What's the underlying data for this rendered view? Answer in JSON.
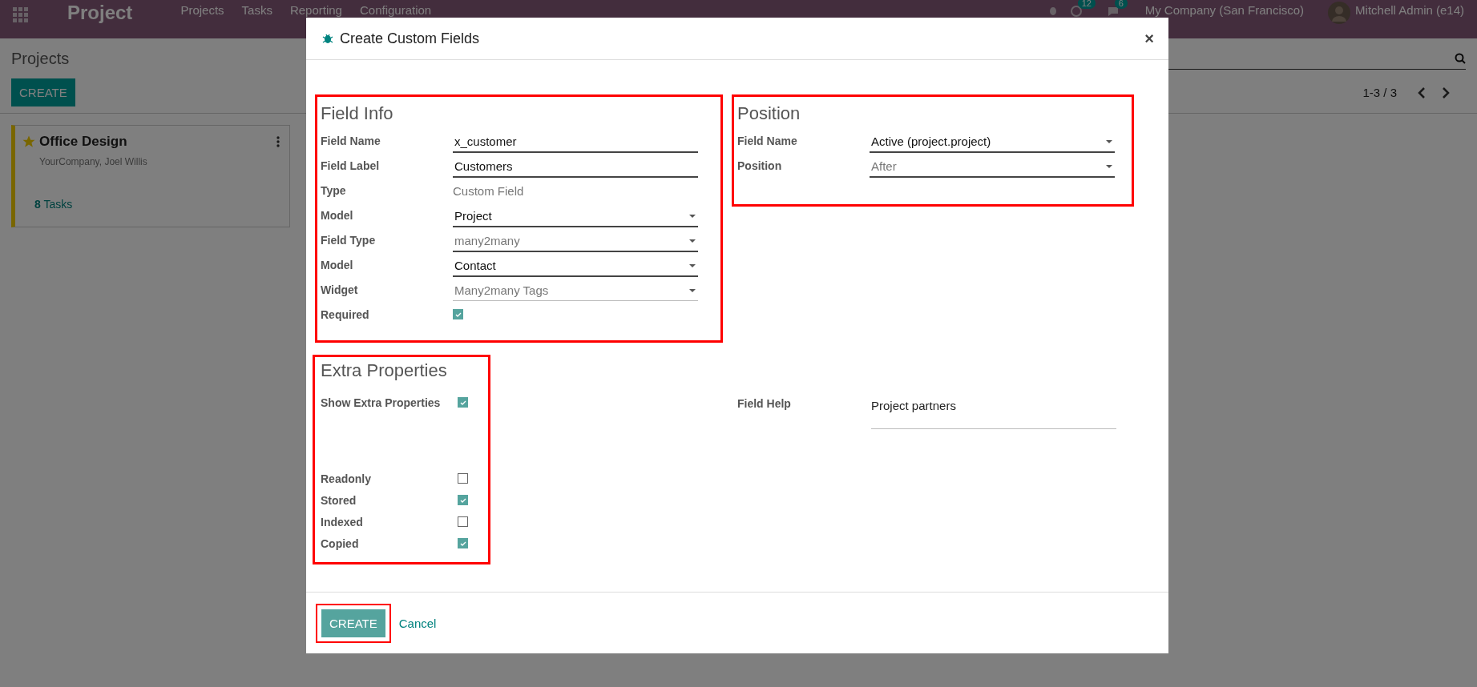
{
  "navbar": {
    "app_title": "Project",
    "menu": [
      "Projects",
      "Tasks",
      "Reporting",
      "Configuration"
    ],
    "activity_badge": "12",
    "messages_badge": "6",
    "company": "My Company (San Francisco)",
    "user": "Mitchell Admin (e14)"
  },
  "control_panel": {
    "title": "Projects",
    "create_button": "CREATE",
    "pager": "1-3 / 3"
  },
  "kanban_card": {
    "title": "Office Design",
    "favorite": true,
    "subtitle": "YourCompany, Joel Willis",
    "tasks_count": "8",
    "tasks_label": "Tasks"
  },
  "dialog": {
    "title": "Create Custom Fields",
    "close": "×",
    "field_info": {
      "title": "Field Info",
      "highlighted": true,
      "rows": [
        {
          "label": "Field Name",
          "kind": "input",
          "value": "x_customer",
          "dimmed": false
        },
        {
          "label": "Field Label",
          "kind": "input",
          "value": "Customers",
          "dimmed": false
        },
        {
          "label": "Type",
          "kind": "text",
          "value": "Custom Field",
          "dimmed": true
        },
        {
          "label": "Model",
          "kind": "select",
          "value": "Project",
          "dimmed": false,
          "light_line": false
        },
        {
          "label": "Field Type",
          "kind": "select",
          "value": "many2many",
          "dimmed": true,
          "light_line": false
        },
        {
          "label": "Model",
          "kind": "select",
          "value": "Contact",
          "dimmed": false,
          "light_line": false
        },
        {
          "label": "Widget",
          "kind": "select",
          "value": "Many2many Tags",
          "dimmed": true,
          "light_line": true
        },
        {
          "label": "Required",
          "kind": "checkbox",
          "checked": true
        }
      ]
    },
    "position": {
      "title": "Position",
      "highlighted": true,
      "rows": [
        {
          "label": "Field Name",
          "kind": "select",
          "value": "Active (project.project)",
          "dimmed": false
        },
        {
          "label": "Position",
          "kind": "select",
          "value": "After",
          "dimmed": true
        }
      ]
    },
    "extra_properties": {
      "title": "Extra Properties",
      "highlighted": true,
      "rows": [
        {
          "label": "Show Extra Properties",
          "kind": "checkbox",
          "checked": true,
          "spaced": true
        },
        {
          "label": "Readonly",
          "kind": "checkbox",
          "checked": false,
          "spaced": false
        },
        {
          "label": "Stored",
          "kind": "checkbox",
          "checked": true,
          "spaced": false
        },
        {
          "label": "Indexed",
          "kind": "checkbox",
          "checked": false,
          "spaced": false
        },
        {
          "label": "Copied",
          "kind": "checkbox",
          "checked": true,
          "spaced": false
        }
      ]
    },
    "field_help": {
      "label": "Field Help",
      "value": "Project partners"
    },
    "footer": {
      "create_button": "CREATE",
      "create_highlighted": true,
      "cancel": "Cancel"
    }
  }
}
